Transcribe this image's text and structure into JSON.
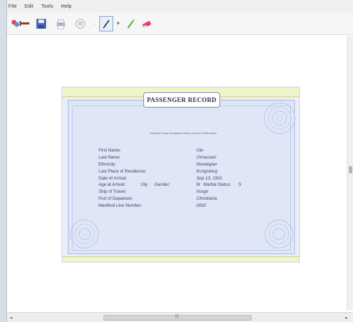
{
  "menu": [
    "File",
    "Edit",
    "Tools",
    "Help"
  ],
  "toolbar": {
    "separator_glyph": "·",
    "dropdown_arrow": "▾",
    "icons": [
      "open-icon",
      "save-icon",
      "print-icon",
      "export-icon",
      "pen-tool-icon",
      "green-pen-icon",
      "eraser-icon"
    ]
  },
  "scrollbars": {
    "left_arrow": "◂",
    "right_arrow": "▸",
    "grip": "|||"
  },
  "certificate": {
    "banner": "PASSENGER RECORD",
    "subtitle": "American Family Immigration History Center® at Ellis Island",
    "fields": [
      {
        "label": "First Name:",
        "value": "Ole"
      },
      {
        "label": "Last Name:",
        "value": "Ormassen"
      },
      {
        "label": "Ethnicity:",
        "value": "Norwegian"
      },
      {
        "label": "Last Place of Residence:",
        "value": "Kongsberg"
      },
      {
        "label": "Date of Arrival:",
        "value": "Sep 13, 1901"
      }
    ],
    "age_row": {
      "age_label": "Age at Arrival:",
      "age_value": "19y",
      "gender_label": "Gender:",
      "gender_value": "M",
      "marital_label": "Marital Status:",
      "marital_value": "S"
    },
    "fields_after": [
      {
        "label": "Ship of Travel:",
        "value": "Norge"
      },
      {
        "label": "Port of Departure:",
        "value": "Christiania"
      },
      {
        "label": "Manifest Line Number:",
        "value": "0002"
      }
    ]
  },
  "colors": {
    "certificate_bg": "#e9eef9",
    "border_band": "#f1f3c8",
    "text": "#3e4563"
  }
}
